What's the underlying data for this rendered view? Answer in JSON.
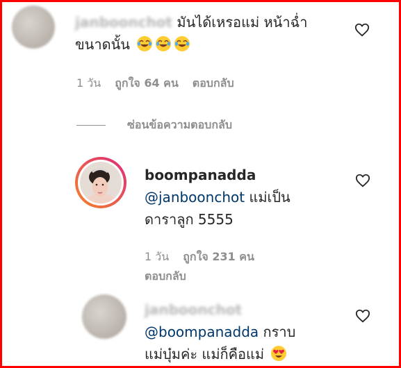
{
  "comment1": {
    "username": "janboonchot",
    "text_line1": "มันได้เหรอแม่ หน้าฉ่ำ",
    "text_line2": "ขนาดนั้น",
    "emoji": [
      "face-with-tears-of-joy",
      "face-with-tears-of-joy",
      "face-with-tears-of-joy"
    ],
    "time": "1 วัน",
    "likes": "ถูกใจ 64 คน",
    "reply": "ตอบกลับ"
  },
  "hide_replies": "ซ่อนข้อความตอบกลับ",
  "reply1": {
    "username": "boompanadda",
    "mention": "@janboonchot",
    "text_line1": " แม่เป็น",
    "text_line2": "ดาราลูก 5555",
    "time": "1 วัน",
    "likes": "ถูกใจ 231 คน",
    "reply": "ตอบกลับ"
  },
  "reply2": {
    "username": "janboonchot",
    "mention": "@boompanadda",
    "text_line1": " กราบ",
    "text_line2": "แม่บุ๋มค่ะ แม่ก็คือแม่",
    "emoji": [
      "smiling-face-with-heart-eyes"
    ]
  },
  "colors": {
    "border": "#ff0000",
    "mention": "#00376b",
    "meta": "#8e8e8e",
    "story_ring_start": "#f58529",
    "story_ring_end": "#dd2a7b"
  }
}
